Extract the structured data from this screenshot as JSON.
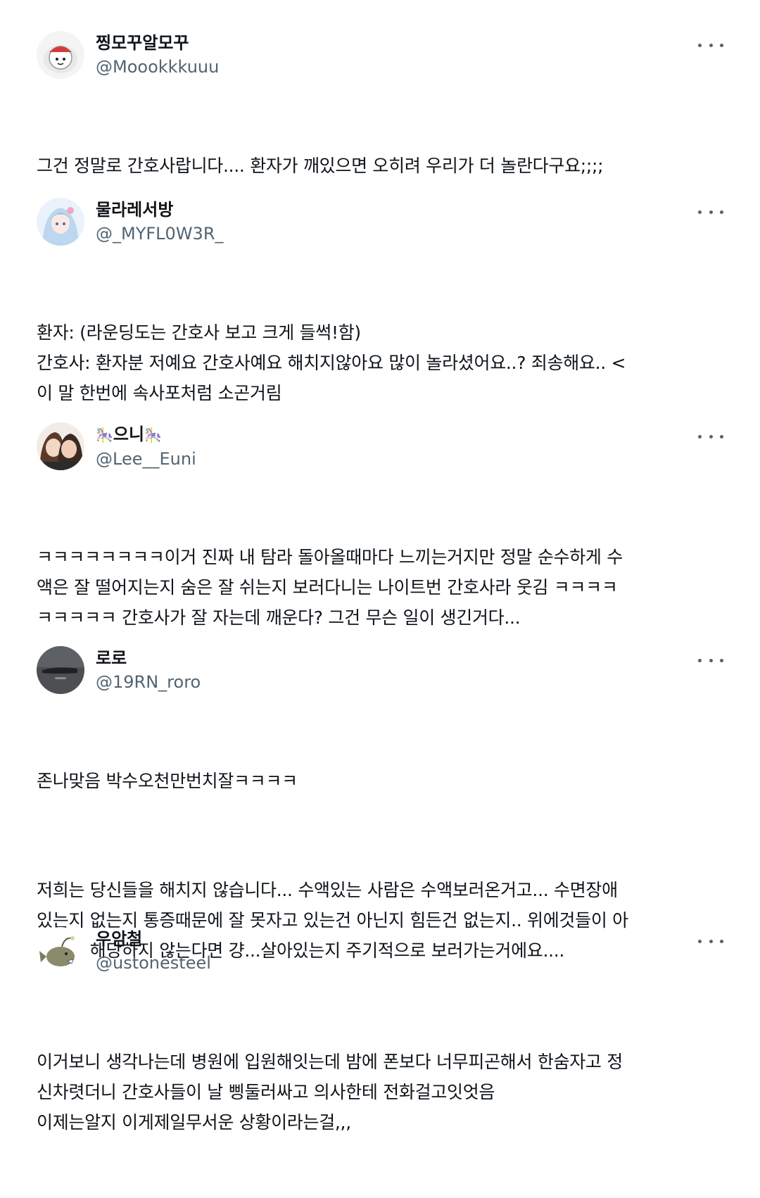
{
  "posts": [
    {
      "display_name": "찡모꾸알모꾸",
      "handle": "@Moookkkuuu",
      "avatar_icon": "cartoon-character-avatar-icon",
      "more_icon": "more-options-icon",
      "paragraphs": [
        "그건 정말로 간호사랍니다.... 환자가 깨있으면 오히려 우리가 더 놀란다구요;;;;"
      ]
    },
    {
      "display_name": "물라레서방",
      "handle": "@_MYFL0W3R_",
      "avatar_icon": "anime-girl-avatar-icon",
      "more_icon": "more-options-icon",
      "paragraphs": [
        "환자: (라운딩도는 간호사 보고 크게 들썩!함)\n간호사: 환자분 저예요 간호사예요 해치지않아요 많이 놀라셨어요..? 죄송해요.. <\n이 말 한번에 속사포처럼 소곤거림"
      ]
    },
    {
      "display_name": "으니",
      "emoji": "🎠",
      "handle": "@Lee__Euni",
      "avatar_icon": "couple-illustration-avatar-icon",
      "more_icon": "more-options-icon",
      "paragraphs": [
        "ㅋㅋㅋㅋㅋㅋㅋㅋ이거 진짜 내 탐라 돌아올때마다 느끼는거지만 정말 순수하게 수\n액은 잘 떨어지는지 숨은 잘 쉬는지 보러다니는 나이트번 간호사라 웃김 ㅋㅋㅋㅋ\nㅋㅋㅋㅋㅋ 간호사가 잘 자는데 깨운다? 그건 무슨 일이 생긴거다..."
      ]
    },
    {
      "display_name": "로로",
      "handle": "@19RN_roro",
      "avatar_icon": "dark-photo-avatar-icon",
      "more_icon": "more-options-icon",
      "paragraphs": [
        "존나맞음 박수오천만번치잘ㅋㅋㅋㅋ",
        "저희는 당신들을 해치지 않습니다... 수액있는 사람은 수액보러온거고... 수면장애\n있는지 없는지 통증때문에 잘 못자고 있는건 아닌지 힘든건 없는지.. 위에것들이 아\n무것도 해당하지 않는다면 걍...살아있는지 주기적으로 보러가는거에요...."
      ]
    },
    {
      "display_name": "우암철",
      "handle": "@ustonesteel",
      "avatar_icon": "anglerfish-avatar-icon",
      "more_icon": "more-options-icon",
      "paragraphs": [
        "이거보니 생각나는데 병원에 입원해잇는데 밤에 폰보다 너무피곤해서 한숨자고 정\n신차렷더니 간호사들이 날 삥둘러싸고 의사한테 전화걸고잇엇음\n이제는알지 이게제일무서운 상황이라는걸,,,"
      ]
    }
  ]
}
